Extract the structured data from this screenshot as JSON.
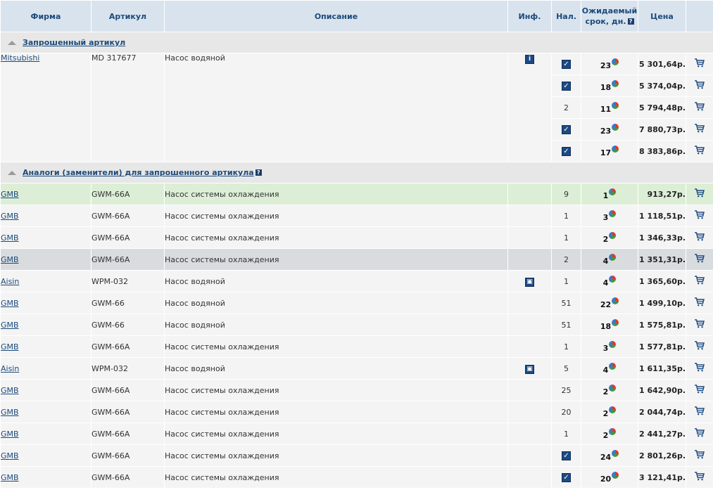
{
  "header": {
    "firm": "Фирма",
    "article": "Артикул",
    "description": "Описание",
    "info": "Инф.",
    "stock": "Нал.",
    "eta_line1": "Ожидаемый",
    "eta_line2": "срок, дн.",
    "price": "Цена"
  },
  "requested": {
    "title": "Запрошенный артикул",
    "firm": "Mitsubishi",
    "article": "MD 317677",
    "description": "Насос водяной",
    "offers": [
      {
        "stock": "check",
        "days": "23",
        "price": "5 301,64р."
      },
      {
        "stock": "check",
        "days": "18",
        "price": "5 374,04р."
      },
      {
        "stock": "2",
        "days": "11",
        "price": "5 794,48р."
      },
      {
        "stock": "check",
        "days": "23",
        "price": "7 880,73р."
      },
      {
        "stock": "check",
        "days": "17",
        "price": "8 383,86р."
      }
    ]
  },
  "analogs": {
    "title": "Аналоги (заменители) для запрошенного артикула",
    "rows": [
      {
        "firm": "GMB",
        "article": "GWM-66A",
        "description": "Насос системы охлаждения",
        "info": "",
        "stock": "9",
        "days": "1",
        "price": "913,27р."
      },
      {
        "firm": "GMB",
        "article": "GWM-66A",
        "description": "Насос системы охлаждения",
        "info": "",
        "stock": "1",
        "days": "3",
        "price": "1 118,51р."
      },
      {
        "firm": "GMB",
        "article": "GWM-66A",
        "description": "Насос системы охлаждения",
        "info": "",
        "stock": "1",
        "days": "2",
        "price": "1 346,33р."
      },
      {
        "firm": "GMB",
        "article": "GWM-66A",
        "description": "Насос системы охлаждения",
        "info": "",
        "stock": "2",
        "days": "4",
        "price": "1 351,31р."
      },
      {
        "firm": "Aisin",
        "article": "WPM-032",
        "description": "Насос водяной",
        "info": "photo",
        "stock": "1",
        "days": "4",
        "price": "1 365,60р."
      },
      {
        "firm": "GMB",
        "article": "GWM-66",
        "description": "Насос водяной",
        "info": "",
        "stock": "51",
        "days": "22",
        "price": "1 499,10р."
      },
      {
        "firm": "GMB",
        "article": "GWM-66",
        "description": "Насос водяной",
        "info": "",
        "stock": "51",
        "days": "18",
        "price": "1 575,81р."
      },
      {
        "firm": "GMB",
        "article": "GWM-66A",
        "description": "Насос системы охлаждения",
        "info": "",
        "stock": "1",
        "days": "3",
        "price": "1 577,81р."
      },
      {
        "firm": "Aisin",
        "article": "WPM-032",
        "description": "Насос водяной",
        "info": "photo",
        "stock": "5",
        "days": "4",
        "price": "1 611,35р."
      },
      {
        "firm": "GMB",
        "article": "GWM-66A",
        "description": "Насос системы охлаждения",
        "info": "",
        "stock": "25",
        "days": "2",
        "price": "1 642,90р."
      },
      {
        "firm": "GMB",
        "article": "GWM-66A",
        "description": "Насос системы охлаждения",
        "info": "",
        "stock": "20",
        "days": "2",
        "price": "2 044,74р."
      },
      {
        "firm": "GMB",
        "article": "GWM-66A",
        "description": "Насос системы охлаждения",
        "info": "",
        "stock": "1",
        "days": "2",
        "price": "2 441,27р."
      },
      {
        "firm": "GMB",
        "article": "GWM-66A",
        "description": "Насос системы охлаждения",
        "info": "",
        "stock": "check",
        "days": "24",
        "price": "2 801,26р."
      },
      {
        "firm": "GMB",
        "article": "GWM-66A",
        "description": "Насос системы охлаждения",
        "info": "",
        "stock": "check",
        "days": "20",
        "price": "3 121,41р."
      }
    ]
  },
  "icons": {
    "cart": "shopping-cart-icon",
    "stock_check": "check-icon",
    "eta_chart": "pie-chart-icon",
    "help": "help-icon",
    "info": "info-icon",
    "photo": "photo-icon"
  },
  "colors": {
    "header_bg": "#d9e3ee",
    "header_text": "#1c4a7a",
    "section_bg": "#e7e7e7",
    "row_bg": "#f4f4f4",
    "highlight_green": "#dcefd6",
    "highlight_grey": "#d9dcdf",
    "icon_blue": "#1c4a84"
  }
}
